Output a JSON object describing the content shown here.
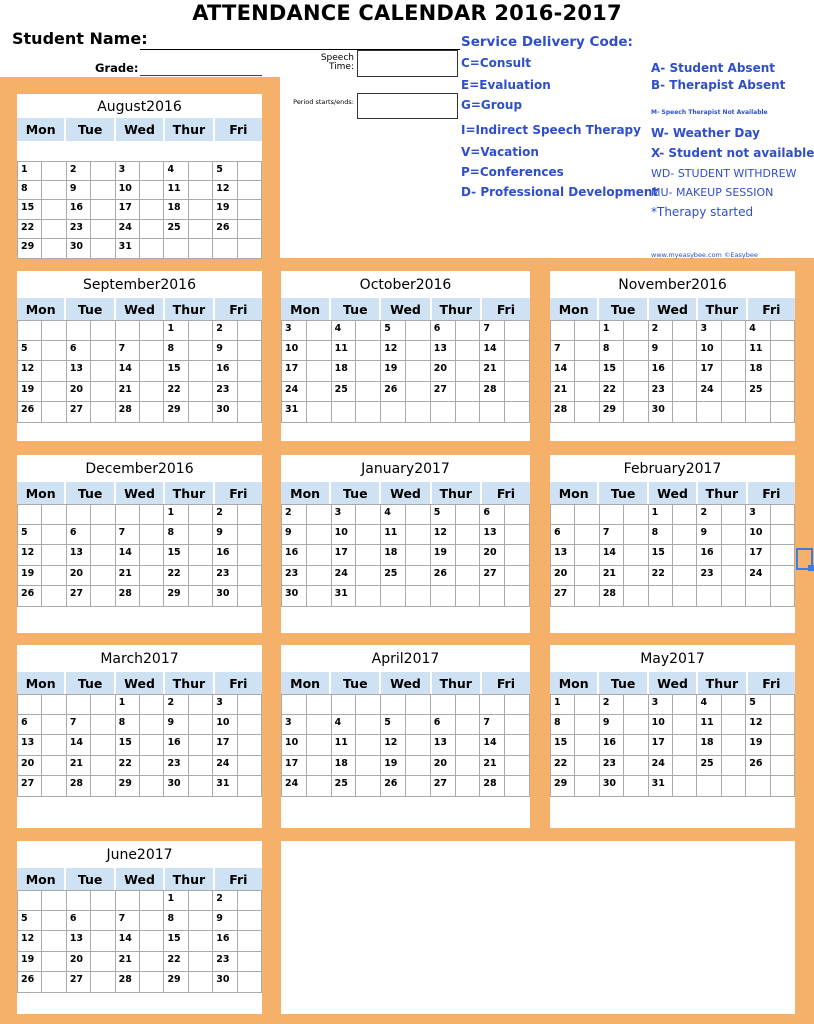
{
  "header": {
    "title": "ATTENDANCE CALENDAR 2016-2017",
    "student_name_label": "Student Name:",
    "student_name_value": "",
    "grade_label": "Grade:",
    "grade_value": "",
    "speech_time_label": "Speech Time:",
    "speech_time_value": "",
    "period_label": "Period starts/ends:",
    "period_value": ""
  },
  "codes": {
    "heading": "Service Delivery Code:",
    "left": [
      "C=Consult",
      "E=Evaluation",
      "G=Group",
      "I=Indirect Speech Therapy",
      "V=Vacation",
      "P=Conferences",
      "D- Professional Development"
    ],
    "right": [
      "A- Student Absent",
      "B- Therapist Absent",
      "M- Speech Therapist Not Available",
      "W- Weather Day",
      "X- Student not available",
      "WD- STUDENT WITHDREW",
      "MU- MAKEUP SESSION",
      "*Therapy started"
    ],
    "footer": "www.myeasybee.com ©Easybee",
    "color": "#2f4fc9"
  },
  "colors": {
    "frame": "#f5b06a",
    "day_header": "#cfe2f3",
    "selection": "#3b7de0"
  },
  "weekdays": [
    "Mon",
    "Tue",
    "Wed",
    "Thur",
    "Fri"
  ],
  "months": [
    {
      "name": "August2016",
      "weeks": [
        null,
        [
          1,
          2,
          3,
          4,
          5
        ],
        [
          8,
          9,
          10,
          11,
          12
        ],
        [
          15,
          16,
          17,
          18,
          19
        ],
        [
          22,
          23,
          24,
          25,
          26
        ],
        [
          29,
          30,
          31,
          "",
          ""
        ]
      ]
    },
    {
      "name": "September2016",
      "weeks": [
        [
          "",
          "",
          "",
          1,
          2
        ],
        [
          5,
          6,
          7,
          8,
          9
        ],
        [
          12,
          13,
          14,
          15,
          16
        ],
        [
          19,
          20,
          21,
          22,
          23
        ],
        [
          26,
          27,
          28,
          29,
          30
        ]
      ]
    },
    {
      "name": "October2016",
      "weeks": [
        [
          3,
          4,
          5,
          6,
          7
        ],
        [
          10,
          11,
          12,
          13,
          14
        ],
        [
          17,
          18,
          19,
          20,
          21
        ],
        [
          24,
          25,
          26,
          27,
          28
        ],
        [
          31,
          "",
          "",
          "",
          ""
        ]
      ]
    },
    {
      "name": "November2016",
      "weeks": [
        [
          "",
          1,
          2,
          3,
          4
        ],
        [
          7,
          8,
          9,
          10,
          11
        ],
        [
          14,
          15,
          16,
          17,
          18
        ],
        [
          21,
          22,
          23,
          24,
          25
        ],
        [
          28,
          29,
          30,
          "",
          ""
        ]
      ]
    },
    {
      "name": "December2016",
      "weeks": [
        [
          "",
          "",
          "",
          1,
          2
        ],
        [
          5,
          6,
          7,
          8,
          9
        ],
        [
          12,
          13,
          14,
          15,
          16
        ],
        [
          19,
          20,
          21,
          22,
          23
        ],
        [
          26,
          27,
          28,
          29,
          30
        ]
      ]
    },
    {
      "name": "January2017",
      "weeks": [
        [
          2,
          3,
          4,
          5,
          6
        ],
        [
          9,
          10,
          11,
          12,
          13
        ],
        [
          16,
          17,
          18,
          19,
          20
        ],
        [
          23,
          24,
          25,
          26,
          27
        ],
        [
          30,
          31,
          "",
          "",
          ""
        ]
      ]
    },
    {
      "name": "February2017",
      "weeks": [
        [
          "",
          "",
          1,
          2,
          3
        ],
        [
          6,
          7,
          8,
          9,
          10
        ],
        [
          13,
          14,
          15,
          16,
          17
        ],
        [
          20,
          21,
          22,
          23,
          24
        ],
        [
          27,
          28,
          "",
          "",
          ""
        ]
      ]
    },
    {
      "name": "March2017",
      "weeks": [
        [
          "",
          "",
          1,
          2,
          3
        ],
        [
          6,
          7,
          8,
          9,
          10
        ],
        [
          13,
          14,
          15,
          16,
          17
        ],
        [
          20,
          21,
          22,
          23,
          24
        ],
        [
          27,
          28,
          29,
          30,
          31
        ]
      ]
    },
    {
      "name": "April2017",
      "weeks": [
        [
          "",
          "",
          "",
          "",
          ""
        ],
        [
          3,
          4,
          5,
          6,
          7
        ],
        [
          10,
          11,
          12,
          13,
          14
        ],
        [
          17,
          18,
          19,
          20,
          21
        ],
        [
          24,
          25,
          26,
          27,
          28
        ]
      ]
    },
    {
      "name": "May2017",
      "weeks": [
        [
          1,
          2,
          3,
          4,
          5
        ],
        [
          8,
          9,
          10,
          11,
          12
        ],
        [
          15,
          16,
          17,
          18,
          19
        ],
        [
          22,
          23,
          24,
          25,
          26
        ],
        [
          29,
          30,
          31,
          "",
          ""
        ]
      ]
    },
    {
      "name": "June2017",
      "weeks": [
        [
          "",
          "",
          "",
          1,
          2
        ],
        [
          5,
          6,
          7,
          8,
          9
        ],
        [
          12,
          13,
          14,
          15,
          16
        ],
        [
          19,
          20,
          21,
          22,
          23
        ],
        [
          26,
          27,
          28,
          29,
          30
        ]
      ]
    }
  ]
}
